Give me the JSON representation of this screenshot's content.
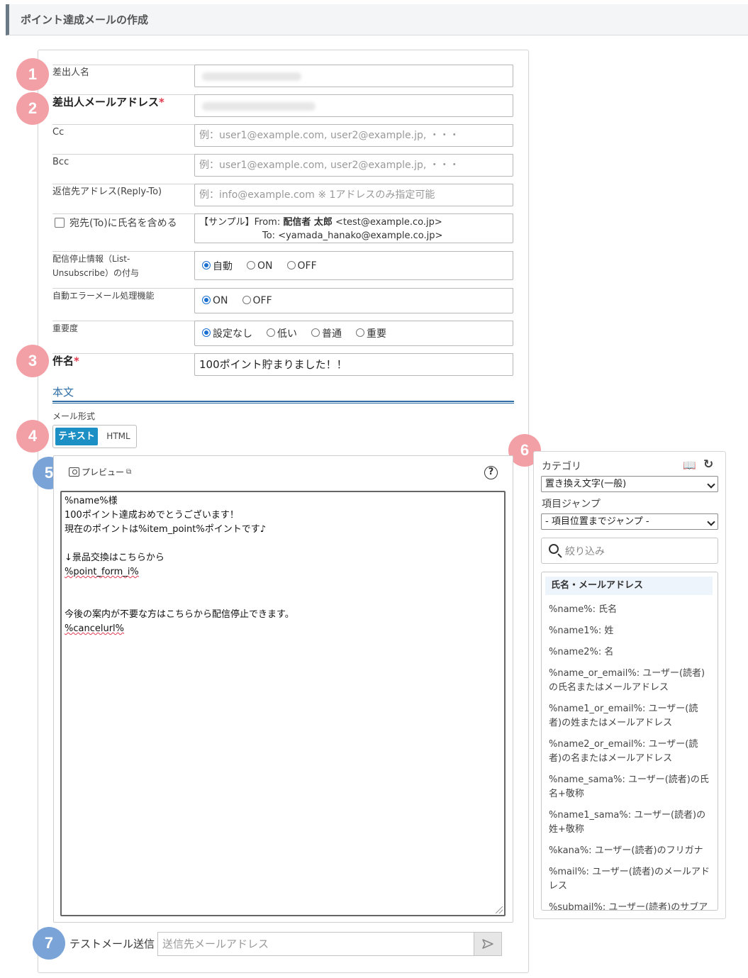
{
  "page": {
    "title": "ポイント達成メールの作成"
  },
  "badges": [
    "1",
    "2",
    "3",
    "4",
    "5",
    "6",
    "7"
  ],
  "form": {
    "sender_name_label": "差出人名",
    "sender_email_label": "差出人メールアドレス",
    "required_mark": "*",
    "cc_label": "Cc",
    "cc_placeholder": "例：user1@example.com, user2@example.jp, ・・・",
    "bcc_label": "Bcc",
    "bcc_placeholder": "例：user1@example.com, user2@example.jp, ・・・",
    "replyto_label": "返信先アドレス(Reply-To)",
    "replyto_placeholder": "例：info@example.com ※ 1アドレスのみ指定可能",
    "include_name_label": "宛先(To)に氏名を含める",
    "sample_prefix": "【サンプル】From: ",
    "sample_from_name": "配信者 太郎",
    "sample_from_addr": " <test@example.co.jp>",
    "sample_to": "To: <yamada_hanako@example.co.jp>",
    "unsubscribe_label_1": "配信停止情報（List-",
    "unsubscribe_label_2": "Unsubscribe）の付与",
    "unsubscribe_options": [
      "自動",
      "ON",
      "OFF"
    ],
    "unsubscribe_selected": "自動",
    "error_label": "自動エラーメール処理機能",
    "error_options": [
      "ON",
      "OFF"
    ],
    "error_selected": "ON",
    "priority_label": "重要度",
    "priority_options": [
      "設定なし",
      "低い",
      "普通",
      "重要"
    ],
    "priority_selected": "設定なし",
    "subject_label": "件名",
    "subject_value": "100ポイント貯まりました！！"
  },
  "body_section": {
    "title": "本文",
    "format_label": "メール形式",
    "format_text": "テキスト",
    "format_html": "HTML",
    "preview_label": "プレビュー",
    "help": "?",
    "lines": [
      "%name%様",
      "100ポイント達成おめでとうございます！",
      "現在のポイントは%item_point%ポイントです♪",
      "",
      "↓景品交換はこちらから",
      "%point_form_i%",
      "",
      "",
      "今後の案内が不要な方はこちらから配信停止できます。",
      "%cancelurl%"
    ]
  },
  "test_send": {
    "label": "テストメール送信",
    "placeholder": "送信先メールアドレス"
  },
  "side": {
    "category_label": "カテゴリ",
    "category_value": "置き換え文字(一般)",
    "jump_label": "項目ジャンプ",
    "jump_value": "- 項目位置までジャンプ -",
    "filter_placeholder": "絞り込み",
    "list_header": "氏名・メールアドレス",
    "tags": [
      [
        "%name%: 氏名"
      ],
      [
        "%name1%: 姓"
      ],
      [
        "%name2%: 名"
      ],
      [
        "%name_or_email%: ユーザー(読者)",
        "の氏名またはメールアドレス"
      ],
      [
        "%name1_or_email%: ユーザー(読",
        "者)の姓またはメールアドレス"
      ],
      [
        "%name2_or_email%: ユーザー(読",
        "者)の名またはメールアドレス"
      ],
      [
        "%name_sama%: ユーザー(読者)の氏",
        "名+敬称"
      ],
      [
        "%name1_sama%: ユーザー(読者)の",
        "姓+敬称"
      ],
      [
        "%kana%: ユーザー(読者)のフリガナ"
      ],
      [
        "%mail%: ユーザー(読者)のメールアド",
        "レス"
      ],
      [
        "%submail%: ユーザー(読者)のサブア"
      ]
    ]
  }
}
